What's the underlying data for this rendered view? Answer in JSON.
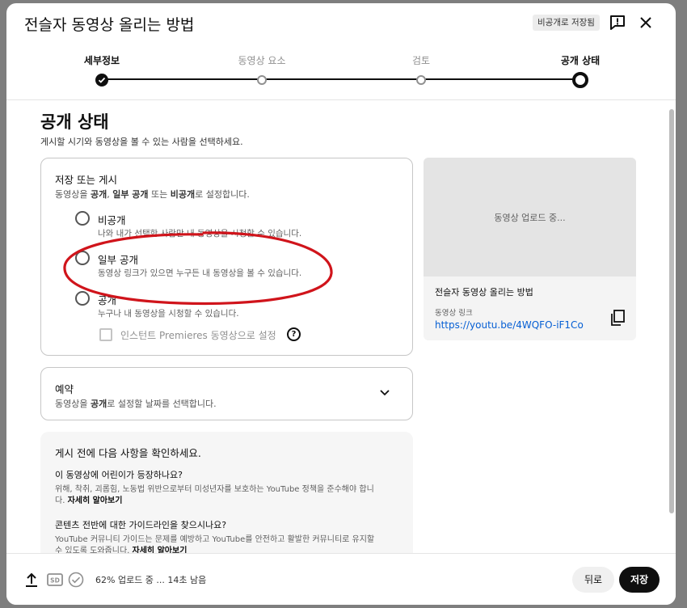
{
  "dialog": {
    "title": "전슬자 동영상 올리는 방법",
    "saved_badge": "비공개로 저장됨"
  },
  "stepper": {
    "steps": [
      {
        "label": "세부정보",
        "state": "done"
      },
      {
        "label": "동영상 요소",
        "state": "pending"
      },
      {
        "label": "검토",
        "state": "pending"
      },
      {
        "label": "공개 상태",
        "state": "current"
      }
    ]
  },
  "visibility": {
    "title": "공개 상태",
    "subtitle": "게시할 시기와 동영상을 볼 수 있는 사람을 선택하세요.",
    "card_title": "저장 또는 게시",
    "card_sub_1": "동영상을 ",
    "card_sub_public": "공개",
    "card_sub_2": ", ",
    "card_sub_unlisted": "일부 공개",
    "card_sub_3": " 또는 ",
    "card_sub_private": "비공개",
    "card_sub_4": "로 설정합니다.",
    "options": [
      {
        "label": "비공개",
        "desc": "나와 내가 선택한 사람만 내 동영상을 시청할 수 있습니다."
      },
      {
        "label": "일부 공개",
        "desc": "동영상 링크가 있으면 누구든 내 동영상을 볼 수 있습니다."
      },
      {
        "label": "공개",
        "desc": "누구나 내 동영상을 시청할 수 있습니다."
      }
    ],
    "premiere_label": "인스턴트 Premieres 동영상으로 설정",
    "help_glyph": "?"
  },
  "schedule": {
    "title": "예약",
    "sub_1": "동영상을 ",
    "sub_bold": "공개",
    "sub_2": "로 설정할 날짜를 선택합니다."
  },
  "checklist": {
    "title": "게시 전에 다음 사항을 확인하세요.",
    "q1": "이 동영상에 어린이가 등장하나요?",
    "a1": "위해, 착취, 괴롭힘, 노동법 위반으로부터 미성년자를 보호하는 YouTube 정책을 준수해야 합니다. ",
    "a1_more": "자세히 알아보기",
    "q2": "콘텐츠 전반에 대한 가이드라인을 찾으시나요?",
    "a2": "YouTube 커뮤니티 가이드는 문제를 예방하고 YouTube를 안전하고 활발한 커뮤니티로 유지할 수 있도록 도와줍니다. ",
    "a2_more": "자세히 알아보기"
  },
  "preview": {
    "uploading": "동영상 업로드 중...",
    "video_title": "전슬자 동영상 올리는 방법",
    "link_label": "동영상 링크",
    "link": "https://youtu.be/4WQFO-iF1Co"
  },
  "footer": {
    "status": "62% 업로드 중 ... 14초 남음",
    "sd_badge": "SD",
    "back": "뒤로",
    "save": "저장"
  },
  "colors": {
    "annotation_ellipse": "#d0141b",
    "link": "#065fd4"
  }
}
